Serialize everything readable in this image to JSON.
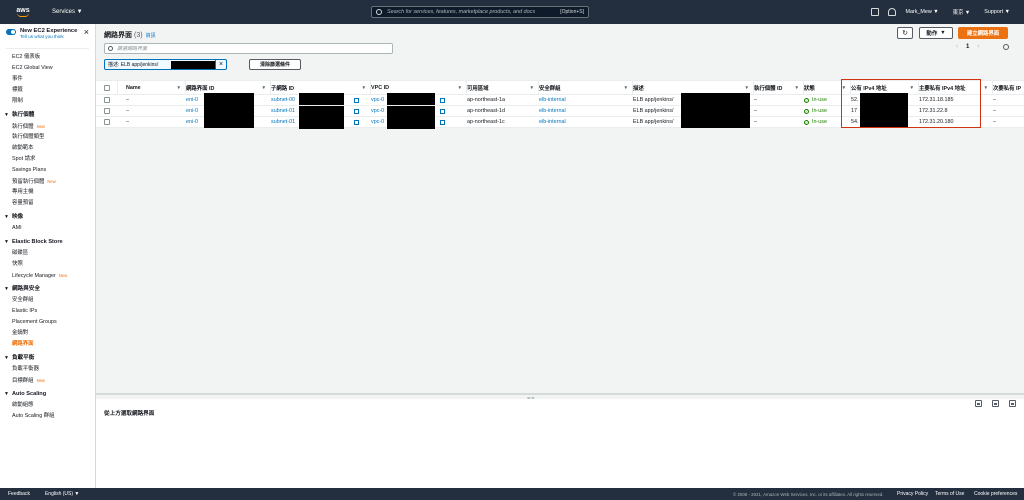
{
  "topbar": {
    "logo": "aws",
    "services": "Services ▼",
    "search_placeholder": "Search for services, features, marketplace products, and docs",
    "search_hint": "[Option+S]",
    "user": "Mark_Mew ▼",
    "region": "東京 ▼",
    "support": "Support ▼"
  },
  "sidebar": {
    "experience_title": "New EC2 Experience",
    "experience_sub": "Tell us what you think",
    "top_items": [
      "EC2 儀表板",
      "EC2 Global View",
      "事件",
      "標籤",
      "限制"
    ],
    "sections": [
      {
        "title": "執行個體",
        "items": [
          {
            "label": "執行個體",
            "badge": "New"
          },
          {
            "label": "執行個體類型",
            "badge": ""
          },
          {
            "label": "啟動範本",
            "badge": ""
          },
          {
            "label": "Spot 請求",
            "badge": ""
          },
          {
            "label": "Savings Plans",
            "badge": ""
          },
          {
            "label": "預留執行個體",
            "badge": "New"
          },
          {
            "label": "專用主機",
            "badge": ""
          },
          {
            "label": "容量預留",
            "badge": ""
          }
        ]
      },
      {
        "title": "映像",
        "items": [
          {
            "label": "AMI",
            "badge": ""
          }
        ]
      },
      {
        "title": "Elastic Block Store",
        "items": [
          {
            "label": "磁碟區",
            "badge": ""
          },
          {
            "label": "快照",
            "badge": ""
          },
          {
            "label": "Lifecycle Manager",
            "badge": "New"
          }
        ]
      },
      {
        "title": "網路與安全",
        "items": [
          {
            "label": "安全群組",
            "badge": ""
          },
          {
            "label": "Elastic IPs",
            "badge": ""
          },
          {
            "label": "Placement Groups",
            "badge": ""
          },
          {
            "label": "金鑰對",
            "badge": ""
          },
          {
            "label": "網路界面",
            "badge": "",
            "active": true
          }
        ]
      },
      {
        "title": "負載平衡",
        "items": [
          {
            "label": "負載平衡器",
            "badge": ""
          },
          {
            "label": "目標群組",
            "badge": "New"
          }
        ]
      },
      {
        "title": "Auto Scaling",
        "items": [
          {
            "label": "啟動組態",
            "badge": ""
          },
          {
            "label": "Auto Scaling 群組",
            "badge": ""
          }
        ]
      }
    ]
  },
  "main": {
    "title": "網路界面",
    "count": "(3)",
    "info": "資訊",
    "actions_label": "動作",
    "create_label": "建立網路界面",
    "filter_placeholder": "篩選網路界面",
    "token": "描述: ELB app/jenkins/",
    "clear_label": "清除篩選條件",
    "page": "1",
    "columns": [
      "Name",
      "網路界面 ID",
      "子網路 ID",
      "VPC ID",
      "可用區域",
      "安全群組",
      "描述",
      "執行個體 ID",
      "狀態",
      "公有 IPv4 地址",
      "主要私有 IPv4 地址",
      "次要私有 IP"
    ],
    "rows": [
      {
        "name": "–",
        "eni": "eni-0",
        "subnet": "subnet-00",
        "vpc": "vpc-0",
        "az": "ap-northeast-1a",
        "sg": "elb-internal",
        "desc": "ELB app/jenkins/",
        "instance": "–",
        "status": "In-use",
        "public_ip": "52.",
        "private_ip": "172.31.18.185",
        "secondary": "–"
      },
      {
        "name": "–",
        "eni": "eni-0",
        "subnet": "subnet-01",
        "vpc": "vpc-0",
        "az": "ap-northeast-1d",
        "sg": "elb-internal",
        "desc": "ELB app/jenkins/",
        "instance": "–",
        "status": "In-use",
        "public_ip": "17",
        "private_ip": "172.31.22.8",
        "secondary": "–"
      },
      {
        "name": "–",
        "eni": "eni-0",
        "subnet": "subnet-01",
        "vpc": "vpc-0",
        "az": "ap-northeast-1c",
        "sg": "elb-internal",
        "desc": "ELB app/jenkins/",
        "instance": "–",
        "status": "In-use",
        "public_ip": "54.",
        "private_ip": "172.31.20.180",
        "secondary": "–"
      }
    ],
    "detail_hint": "從上方選取網路界面"
  },
  "footer": {
    "feedback": "Feedback",
    "language": "English (US) ▼",
    "copyright": "© 2008 - 2021, Amazon Web Services, Inc. or its affiliates. All rights reserved.",
    "privacy": "Privacy Policy",
    "terms": "Terms of Use",
    "cookies": "Cookie preferences"
  },
  "colors": {
    "accent": "#ec7211",
    "link": "#0073bb",
    "highlight": "#d13212",
    "nav": "#232f3e",
    "status_ok": "#1d8102"
  }
}
